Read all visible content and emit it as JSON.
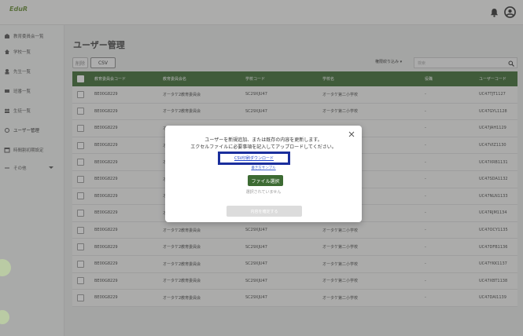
{
  "app": {
    "logo_text": "EduR",
    "icons": [
      "bell-icon",
      "user-circle-icon"
    ]
  },
  "sidebar": {
    "items": [
      {
        "label": "教育委員会一覧",
        "icon": "school-building-icon"
      },
      {
        "label": "学校一覧",
        "icon": "home-icon"
      },
      {
        "label": "先生一覧",
        "icon": "teacher-icon"
      },
      {
        "label": "班番一覧",
        "icon": "class-icon"
      },
      {
        "label": "生徒一覧",
        "icon": "students-icon"
      },
      {
        "label": "ユーザー管理",
        "icon": "user-manage-icon"
      },
      {
        "label": "時間割初期設定",
        "icon": "calendar-icon"
      },
      {
        "label": "その他",
        "icon": "more-icon"
      }
    ],
    "active_index": 5
  },
  "main": {
    "title": "ユーザー管理",
    "delete_label": "削除",
    "csv_label": "CSV",
    "filter_label": "権限絞り込み ▾",
    "search_placeholder": "検索",
    "columns": [
      "教育委員会コード",
      "教育委員会名",
      "学校コード",
      "学校名",
      "役職",
      "ユーザーコード"
    ],
    "rows": [
      [
        "BE00G8229",
        "オータケ2教育委員会",
        "SC29XJU47",
        "オータケ第二小学校",
        "-",
        "UC47TJT1127"
      ],
      [
        "BE00G8229",
        "オータケ2教育委員会",
        "SC29XJU47",
        "オータケ第二小学校",
        "-",
        "UC47GYL1128"
      ],
      [
        "BE00G8229",
        "オータケ2教育委員会",
        "SC29XJU47",
        "オータケ第二小学校",
        "-",
        "UC47JAH1129"
      ],
      [
        "BE00G8229",
        "オータケ2教育委員会",
        "SC29XJU47",
        "オータケ第二小学校",
        "-",
        "UC47VIZ1130"
      ],
      [
        "BE00G8229",
        "オータケ2教育委員会",
        "SC29XJU47",
        "オータケ第二小学校",
        "-",
        "UC47XRB1131"
      ],
      [
        "BE00G8229",
        "オータケ2教育委員会",
        "SC29XJU47",
        "オータケ第二小学校",
        "-",
        "UC47SDA1132"
      ],
      [
        "BE00G8229",
        "オータケ2教育委員会",
        "SC29XJU47",
        "オータケ第二小学校",
        "-",
        "UC47NLN1133"
      ],
      [
        "BE00G8229",
        "オータケ2教育委員会",
        "SC29XJU47",
        "オータケ第二小学校",
        "-",
        "UC47RJM1134"
      ],
      [
        "BE00G8229",
        "オータケ2教育委員会",
        "SC29XJU47",
        "オータケ第二小学校",
        "-",
        "UC47OCY1135"
      ],
      [
        "BE00G8229",
        "オータケ2教育委員会",
        "SC29XJU47",
        "オータケ第二小学校",
        "-",
        "UC47DFB1136"
      ],
      [
        "BE00G8229",
        "オータケ2教育委員会",
        "SC29XJU47",
        "オータケ第二小学校",
        "-",
        "UC47YKK1137"
      ],
      [
        "BE00G8229",
        "オータケ2教育委員会",
        "SC29XJU47",
        "オータケ第二小学校",
        "-",
        "UC47XBT1138"
      ],
      [
        "BE00G8229",
        "オータケ2教育委員会",
        "SC29XJU47",
        "オータケ第二小学校",
        "-",
        "UC47DAI1139"
      ]
    ]
  },
  "modal": {
    "line1": "ユーザーを新規追加、または既存の内容を更新します。",
    "line2": "エクセルファイルに必要事項を記入してアップロードしてください。",
    "csv_download": "CSV印刷ダウンロード",
    "sample_link": "書き方サンプル",
    "file_select": "ファイル選択",
    "no_file": "選択されていません",
    "confirm": "内容を確定する"
  },
  "colors": {
    "header_green": "#3d6b33",
    "link_blue": "#2244cc",
    "highlight_border": "#1a2e9c"
  }
}
